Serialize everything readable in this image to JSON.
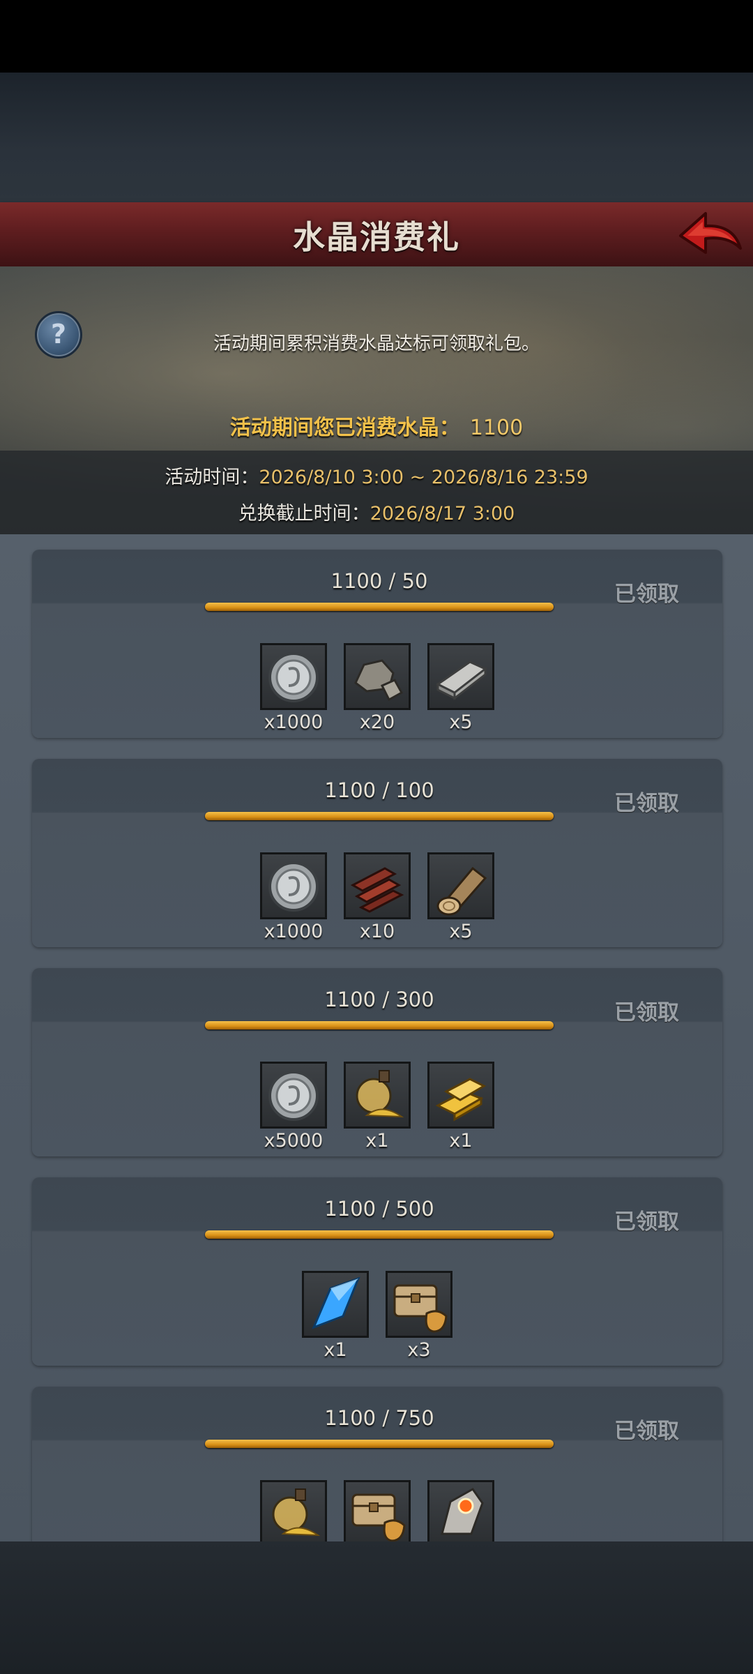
{
  "header": {
    "title": "水晶消费礼"
  },
  "banner": {
    "description": "活动期间累积消费水晶达标可领取礼包。",
    "spent_label": "活动期间您已消费水晶：",
    "spent_value": "1100",
    "activity_time_label": "活动时间：",
    "activity_time_value": "2026/8/10 3:00 ~ 2026/8/16 23:59",
    "deadline_label": "兑换截止时间：",
    "deadline_value": "2026/8/17 3:00"
  },
  "tiers": [
    {
      "progress": "1100 / 50",
      "status": "已领取",
      "rewards": [
        {
          "icon": "silver-coin-icon",
          "qty": "x1000"
        },
        {
          "icon": "stone-icon",
          "qty": "x20"
        },
        {
          "icon": "iron-bar-icon",
          "qty": "x5"
        }
      ]
    },
    {
      "progress": "1100 / 100",
      "status": "已领取",
      "rewards": [
        {
          "icon": "silver-coin-icon",
          "qty": "x1000"
        },
        {
          "icon": "planks-icon",
          "qty": "x10"
        },
        {
          "icon": "log-icon",
          "qty": "x5"
        }
      ]
    },
    {
      "progress": "1100 / 300",
      "status": "已领取",
      "rewards": [
        {
          "icon": "silver-coin-icon",
          "qty": "x5000"
        },
        {
          "icon": "gold-dust-flask-icon",
          "qty": "x1"
        },
        {
          "icon": "gold-bars-icon",
          "qty": "x1"
        }
      ]
    },
    {
      "progress": "1100 / 500",
      "status": "已领取",
      "rewards": [
        {
          "icon": "blue-crystal-icon",
          "qty": "x1"
        },
        {
          "icon": "treasure-chest-icon",
          "qty": "x3"
        }
      ]
    },
    {
      "progress": "1100 / 750",
      "status": "已领取",
      "rewards": [
        {
          "icon": "gold-dust-flask-icon",
          "qty": ""
        },
        {
          "icon": "treasure-chest-icon",
          "qty": ""
        },
        {
          "icon": "gem-stone-icon",
          "qty": ""
        }
      ]
    }
  ]
}
